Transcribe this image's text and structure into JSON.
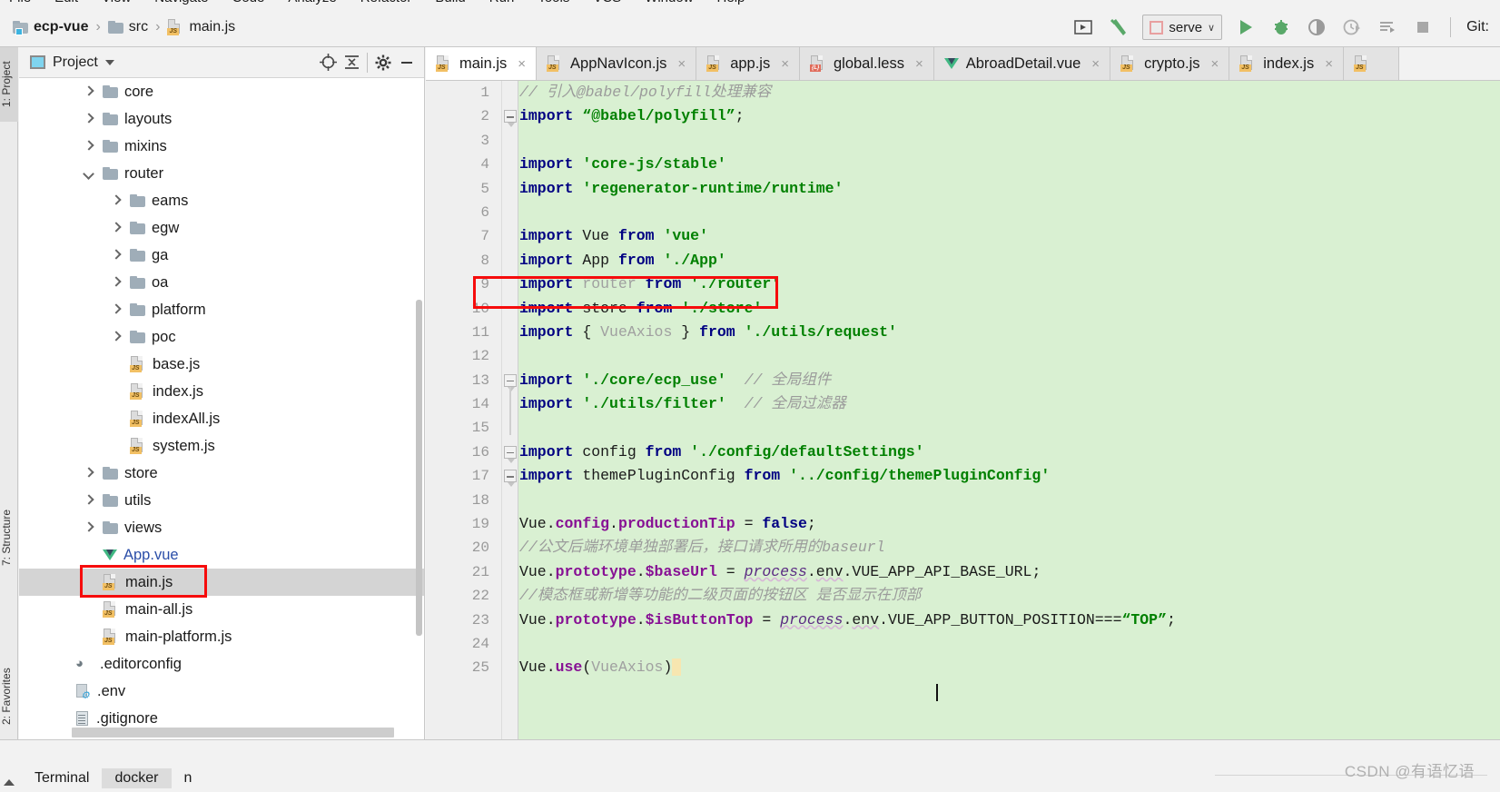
{
  "menubar": {
    "items": [
      "File",
      "Edit",
      "View",
      "Navigate",
      "Code",
      "Analyze",
      "Refactor",
      "Build",
      "Run",
      "Tools",
      "VCS",
      "Window",
      "Help"
    ]
  },
  "toolbar": {
    "breadcrumbs": [
      {
        "label": "ecp-vue",
        "icon": "project-folder-icon",
        "bold": true
      },
      {
        "label": "src",
        "icon": "folder-icon",
        "bold": false
      },
      {
        "label": "main.js",
        "icon": "js-file-icon",
        "bold": false
      }
    ],
    "separator": "›",
    "run_config": {
      "label": "serve",
      "icon": "npm-icon",
      "chevron": "∨"
    },
    "actions": [
      {
        "name": "open-in-browser-icon",
        "glyph": "▶"
      },
      {
        "name": "build-hammer-icon",
        "glyph": "↖"
      },
      {
        "name": "run-icon",
        "glyph": "▶"
      },
      {
        "name": "debug-icon",
        "glyph": "☢"
      },
      {
        "name": "run-with-coverage-icon",
        "glyph": "◑"
      },
      {
        "name": "profile-icon",
        "glyph": "◴"
      },
      {
        "name": "run-dashboard-icon",
        "glyph": "≡"
      },
      {
        "name": "stop-icon",
        "glyph": "■"
      }
    ],
    "git_label": "Git:"
  },
  "left_rail": {
    "items": [
      {
        "label": "1: Project",
        "selected": true
      },
      {
        "label": "7: Structure",
        "selected": false
      },
      {
        "label": "2: Favorites",
        "selected": false
      }
    ]
  },
  "project_panel": {
    "title": "Project",
    "header_icons": [
      {
        "name": "locate-target-icon",
        "glyph": "⊕"
      },
      {
        "name": "collapse-all-icon",
        "glyph": "≡"
      },
      {
        "name": "settings-gear-icon",
        "glyph": "⚙"
      },
      {
        "name": "hide-panel-icon",
        "glyph": "—"
      }
    ],
    "tree": [
      {
        "label": "core",
        "type": "folder",
        "indent": 1,
        "arrow": "right"
      },
      {
        "label": "layouts",
        "type": "folder",
        "indent": 1,
        "arrow": "right"
      },
      {
        "label": "mixins",
        "type": "folder",
        "indent": 1,
        "arrow": "right"
      },
      {
        "label": "router",
        "type": "folder",
        "indent": 1,
        "arrow": "down"
      },
      {
        "label": "eams",
        "type": "folder",
        "indent": 2,
        "arrow": "right"
      },
      {
        "label": "egw",
        "type": "folder",
        "indent": 2,
        "arrow": "right"
      },
      {
        "label": "ga",
        "type": "folder",
        "indent": 2,
        "arrow": "right"
      },
      {
        "label": "oa",
        "type": "folder",
        "indent": 2,
        "arrow": "right"
      },
      {
        "label": "platform",
        "type": "folder",
        "indent": 2,
        "arrow": "right"
      },
      {
        "label": "poc",
        "type": "folder",
        "indent": 2,
        "arrow": "right"
      },
      {
        "label": "base.js",
        "type": "js",
        "indent": 2,
        "arrow": "none"
      },
      {
        "label": "index.js",
        "type": "js",
        "indent": 2,
        "arrow": "none"
      },
      {
        "label": "indexAll.js",
        "type": "js",
        "indent": 2,
        "arrow": "none"
      },
      {
        "label": "system.js",
        "type": "js",
        "indent": 2,
        "arrow": "none"
      },
      {
        "label": "store",
        "type": "folder",
        "indent": 1,
        "arrow": "right"
      },
      {
        "label": "utils",
        "type": "folder",
        "indent": 1,
        "arrow": "right"
      },
      {
        "label": "views",
        "type": "folder",
        "indent": 1,
        "arrow": "right"
      },
      {
        "label": "App.vue",
        "type": "vue",
        "indent": 1,
        "arrow": "none",
        "blue": true
      },
      {
        "label": "main.js",
        "type": "js",
        "indent": 1,
        "arrow": "none",
        "selected": true,
        "highlighted": true
      },
      {
        "label": "main-all.js",
        "type": "js",
        "indent": 1,
        "arrow": "none"
      },
      {
        "label": "main-platform.js",
        "type": "js",
        "indent": 1,
        "arrow": "none"
      },
      {
        "label": ".editorconfig",
        "type": "editorconfig",
        "indent": 0,
        "arrow": "none"
      },
      {
        "label": ".env",
        "type": "env",
        "indent": 0,
        "arrow": "none"
      },
      {
        "label": ".gitignore",
        "type": "text",
        "indent": 0,
        "arrow": "none"
      }
    ]
  },
  "editor": {
    "tabs": [
      {
        "label": "main.js",
        "type": "js",
        "active": true,
        "close": "×"
      },
      {
        "label": "AppNavIcon.js",
        "type": "js",
        "active": false,
        "close": "×"
      },
      {
        "label": "app.js",
        "type": "js",
        "active": false,
        "close": "×"
      },
      {
        "label": "global.less",
        "type": "less",
        "active": false,
        "close": "×"
      },
      {
        "label": "AbroadDetail.vue",
        "type": "vue",
        "active": false,
        "close": "×"
      },
      {
        "label": "crypto.js",
        "type": "js",
        "active": false,
        "close": "×"
      },
      {
        "label": "index.js",
        "type": "js",
        "active": false,
        "close": "×"
      },
      {
        "label": "",
        "type": "js",
        "active": false,
        "close": ""
      }
    ],
    "lines": [
      {
        "n": "1",
        "html": "<span class='cmt'>// 引入@babel/polyfill处理兼容</span>"
      },
      {
        "n": "2",
        "fold": "tip",
        "html": "<span class='kw'>import</span> <span class='str'>“@babel/polyfill”</span><span class='plain'>;</span>"
      },
      {
        "n": "3",
        "html": ""
      },
      {
        "n": "4",
        "html": "<span class='kw'>import</span> <span class='str'>'core-js/stable'</span>"
      },
      {
        "n": "5",
        "html": "<span class='kw'>import</span> <span class='str'>'regenerator-runtime/runtime'</span>"
      },
      {
        "n": "6",
        "html": ""
      },
      {
        "n": "7",
        "html": "<span class='kw'>import</span> <span class='plain'>Vue</span> <span class='kw'>from</span> <span class='str'>'vue'</span>"
      },
      {
        "n": "8",
        "html": "<span class='kw'>import</span> <span class='plain'>App</span> <span class='kw'>from</span> <span class='str'>'./App'</span>"
      },
      {
        "n": "9",
        "html": "<span class='kw'>import</span> <span class='grey'>router</span> <span class='kw'>from</span> <span class='str'>'./router'</span>"
      },
      {
        "n": "10",
        "html": "<span class='kw'>import</span> <span class='plain'>store</span> <span class='kw'>from</span> <span class='str'>'./store'</span>"
      },
      {
        "n": "11",
        "html": "<span class='kw'>import</span> <span class='plain'>{</span> <span class='grey'>VueAxios</span> <span class='plain'>}</span> <span class='kw'>from</span> <span class='str'>'./utils/request'</span>"
      },
      {
        "n": "12",
        "html": ""
      },
      {
        "n": "13",
        "fold": "tip",
        "html": "<span class='kw'>import</span> <span class='str'>'./core/ecp_use'</span>  <span class='cmt'>// 全局组件</span>"
      },
      {
        "n": "14",
        "html": "<span class='kw'>import</span> <span class='str'>'./utils/filter'</span>  <span class='cmt'>// 全局过滤器</span>"
      },
      {
        "n": "15",
        "html": ""
      },
      {
        "n": "16",
        "fold": "tip",
        "html": "<span class='kw'>import</span> <span class='plain'>config</span> <span class='kw'>from</span> <span class='str'>'./config/defaultSettings'</span>"
      },
      {
        "n": "17",
        "fold": "tip",
        "html": "<span class='kw'>import</span> <span class='plain'>themePluginConfig</span> <span class='kw'>from</span> <span class='str'>'../config/themePluginConfig'</span>"
      },
      {
        "n": "18",
        "html": ""
      },
      {
        "n": "19",
        "html": "<span class='plain'>Vue.</span><span class='prop'>config</span><span class='plain'>.</span><span class='prop'>productionTip</span> <span class='plain'>=</span> <span class='kw'>false</span><span class='plain'>;</span>"
      },
      {
        "n": "20",
        "html": "<span class='cmt'>//公文后端环境单独部署后，接口请求所用的baseurl</span>"
      },
      {
        "n": "21",
        "html": "<span class='plain'>Vue.</span><span class='prop'>prototype</span><span class='plain'>.</span><span class='prop'>$baseUrl</span> <span class='plain'>=</span> <span class='ital squig'>process</span><span class='plain'>.</span><span class='squig'>env</span><span class='plain'>.VUE_APP_API_BASE_URL;</span>"
      },
      {
        "n": "22",
        "html": "<span class='cmt'>//模态框或新增等功能的二级页面的按钮区 是否显示在顶部</span>"
      },
      {
        "n": "23",
        "html": "<span class='plain'>Vue.</span><span class='prop'>prototype</span><span class='plain'>.</span><span class='prop'>$isButtonTop</span> <span class='plain'>=</span> <span class='ital squig'>process</span><span class='plain'>.</span><span class='squig'>env</span><span class='plain'>.VUE_APP_BUTTON_POSITION===</span><span class='str'>“TOP”</span><span class='plain'>;</span>"
      },
      {
        "n": "24",
        "html": ""
      },
      {
        "n": "25",
        "html": "<span class='plain'>Vue.</span><span class='prop'>use</span><span class='plain'>(</span><span class='grey'>VueAxios</span><span class='plain'>)</span><span class='hl-yellow'>&nbsp;</span>"
      }
    ],
    "highlight_line": 9
  },
  "bottom": {
    "tabs": [
      {
        "label": "Terminal",
        "selected": false
      },
      {
        "label": "docker",
        "selected": true
      },
      {
        "label": "n",
        "selected": false
      }
    ]
  },
  "watermark": "CSDN @有语忆语",
  "colors": {
    "editor_bg": "#d9f0d2",
    "accent_red": "#f60c0c",
    "keyword": "#000082",
    "string": "#008000",
    "comment": "#9b9b9b",
    "property": "#871094"
  }
}
